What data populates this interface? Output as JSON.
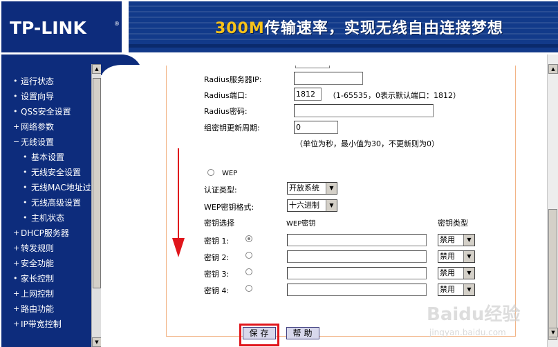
{
  "header": {
    "logo": "TP-LINK",
    "logo_reg": "®",
    "banner_highlight": "300M",
    "banner_text": "传输速率，实现无线自由连接梦想"
  },
  "sidebar": {
    "items": [
      {
        "label": "运行状态",
        "bullet": "•",
        "sub": false
      },
      {
        "label": "设置向导",
        "bullet": "•",
        "sub": false
      },
      {
        "label": "QSS安全设置",
        "bullet": "•",
        "sub": false
      },
      {
        "label": "网络参数",
        "bullet": "+",
        "sub": false
      },
      {
        "label": "无线设置",
        "bullet": "−",
        "sub": false
      },
      {
        "label": "基本设置",
        "bullet": "•",
        "sub": true
      },
      {
        "label": "无线安全设置",
        "bullet": "•",
        "sub": true
      },
      {
        "label": "无线MAC地址过滤",
        "bullet": "•",
        "sub": true
      },
      {
        "label": "无线高级设置",
        "bullet": "•",
        "sub": true
      },
      {
        "label": "主机状态",
        "bullet": "•",
        "sub": true
      },
      {
        "label": "DHCP服务器",
        "bullet": "+",
        "sub": false
      },
      {
        "label": "转发规则",
        "bullet": "+",
        "sub": false
      },
      {
        "label": "安全功能",
        "bullet": "+",
        "sub": false
      },
      {
        "label": "家长控制",
        "bullet": "•",
        "sub": false
      },
      {
        "label": "上网控制",
        "bullet": "+",
        "sub": false
      },
      {
        "label": "路由功能",
        "bullet": "+",
        "sub": false
      },
      {
        "label": "IP带宽控制",
        "bullet": "+",
        "sub": false
      }
    ]
  },
  "form": {
    "radius_ip_label": "Radius服务器IP:",
    "radius_ip_value": "",
    "radius_port_label": "Radius端口:",
    "radius_port_value": "1812",
    "radius_port_hint": "（1-65535，0表示默认端口：1812）",
    "radius_pwd_label": "Radius密码:",
    "radius_pwd_value": "",
    "group_key_label": "组密钥更新周期:",
    "group_key_value": "0",
    "group_key_hint": "（单位为秒，最小值为30，不更新则为0）",
    "wep_label": "WEP",
    "auth_type_label": "认证类型:",
    "auth_type_value": "开放系统",
    "wep_format_label": "WEP密钥格式:",
    "wep_format_value": "十六进制",
    "col_key_select": "密钥选择",
    "col_wep_key": "WEP密钥",
    "col_key_type": "密钥类型",
    "keys": [
      {
        "label": "密钥 1:",
        "value": "",
        "type": "禁用",
        "selected": true
      },
      {
        "label": "密钥 2:",
        "value": "",
        "type": "禁用",
        "selected": false
      },
      {
        "label": "密钥 3:",
        "value": "",
        "type": "禁用",
        "selected": false
      },
      {
        "label": "密钥 4:",
        "value": "",
        "type": "禁用",
        "selected": false
      }
    ]
  },
  "buttons": {
    "save": "保存",
    "help": "帮助"
  },
  "watermark": {
    "text": "Baidu经验",
    "url": "jingyan.baidu.com"
  },
  "colors": {
    "nav_bg": "#0d2c7c",
    "panel_border": "#f2b486",
    "highlight": "#e0161c",
    "banner_accent": "#f7c21a"
  }
}
